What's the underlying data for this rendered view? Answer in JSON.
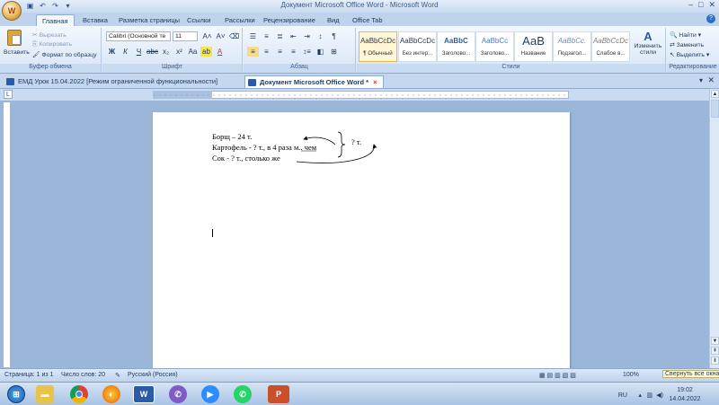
{
  "window": {
    "title": "Документ Microsoft Office Word - Microsoft Word"
  },
  "ribbon_tabs": [
    "Главная",
    "Вставка",
    "Разметка страницы",
    "Ссылки",
    "Рассылки",
    "Рецензирование",
    "Вид",
    "Office Tab"
  ],
  "clipboard": {
    "paste": "Вставить",
    "cut": "Вырезать",
    "copy": "Копировать",
    "format_painter": "Формат по образцу",
    "group_label": "Буфер обмена"
  },
  "font": {
    "family": "Calibri (Основной те",
    "size": "11",
    "group_label": "Шрифт"
  },
  "paragraph": {
    "group_label": "Абзац"
  },
  "styles": {
    "group_label": "Стили",
    "items": [
      {
        "preview": "AaBbCcDc",
        "name": "¶ Обычный"
      },
      {
        "preview": "AaBbCcDc",
        "name": "Без интер..."
      },
      {
        "preview": "AaBbC",
        "name": "Заголово..."
      },
      {
        "preview": "AaBbCc",
        "name": "Заголово..."
      },
      {
        "preview": "АаВ",
        "name": "Название"
      },
      {
        "preview": "AaBbCc.",
        "name": "Подзагол..."
      },
      {
        "preview": "AaBbCcDc",
        "name": "Слабое в..."
      }
    ],
    "change_styles": "Изменить стили"
  },
  "editing": {
    "find": "Найти",
    "replace": "Заменить",
    "select": "Выделить",
    "group_label": "Редактирование"
  },
  "doc_tabs": [
    {
      "label": "ЕМД Урок 15.04.2022 [Режим ограниченной функциональности]"
    },
    {
      "label": "Документ Microsoft Office Word *"
    }
  ],
  "document": {
    "lines": [
      "Борщ – 24 т.",
      "Картофель - ? т., в 4 раза м.. чем",
      "Сок  - ? т.,  столько же"
    ],
    "brace_label": "? т."
  },
  "status": {
    "page": "Страница: 1 из 1",
    "words": "Число слов: 20",
    "language": "Русский (Россия)",
    "zoom": "100%",
    "collapse": "Свернуть все окна"
  },
  "taskbar": {
    "lang": "RU",
    "time": "19:02",
    "date": "14.04.2022"
  },
  "colors": {
    "ribbon_bg": "#d7e5f6",
    "accent": "#2b5ba8"
  }
}
